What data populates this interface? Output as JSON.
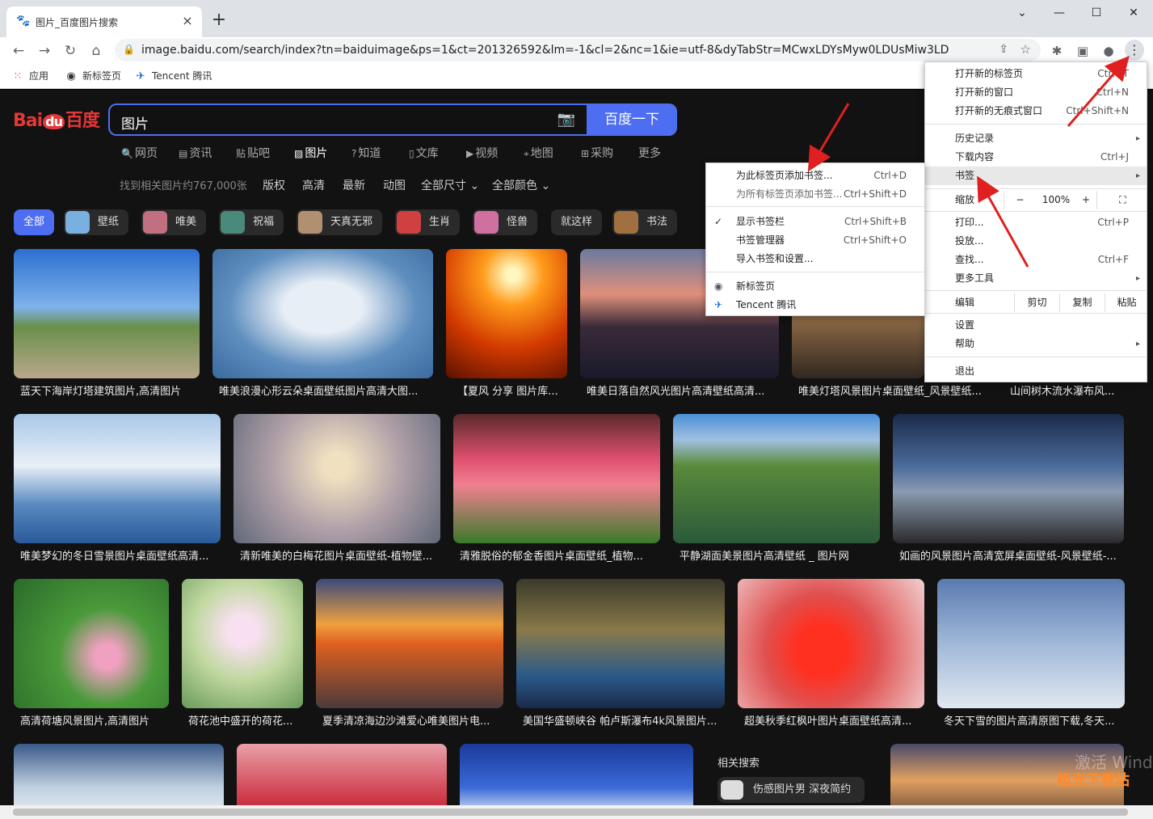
{
  "tab": {
    "title": "图片_百度图片搜索",
    "close": "×",
    "new_tab": "+"
  },
  "window": {
    "minimize": "⌄",
    "min": "—",
    "max": "☐",
    "close": "✕"
  },
  "toolbar": {
    "url": "image.baidu.com/search/index?tn=baiduimage&ps=1&ct=201326592&lm=-1&cl=2&nc=1&ie=utf-8&dyTabStr=MCwxLDYsMyw0LDUsMiw3LDgsOQ%3...",
    "back_icon": "←",
    "forward_icon": "→",
    "reload_icon": "↻",
    "home_icon": "⌂",
    "menu_icon": "⋮"
  },
  "bookmarks": [
    {
      "label": "应用",
      "icon": "apps-icon"
    },
    {
      "label": "新标签页",
      "icon": "globe-icon"
    },
    {
      "label": "Tencent 腾讯",
      "icon": "tencent-icon"
    }
  ],
  "baidu": {
    "logo_left": "Bai",
    "logo_mid": "du",
    "logo_right": "百度",
    "search_value": "图片",
    "search_button": "百度一下",
    "nav": [
      "网页",
      "资讯",
      "贴吧",
      "图片",
      "知道",
      "文库",
      "视频",
      "地图",
      "采购",
      "更多"
    ],
    "result_count": "找到相关图片约767,000张",
    "filters": [
      "版权",
      "高清",
      "最新",
      "动图",
      "全部尺寸",
      "全部颜色"
    ],
    "chips": [
      "全部",
      "壁纸",
      "唯美",
      "祝福",
      "天真无邪",
      "生肖",
      "怪兽",
      "就这样",
      "书法"
    ],
    "related_title": "相关搜索",
    "related_chip": "伤感图片男 深夜简约",
    "watermark": "激活 Wind",
    "watermark2": "极光下载站"
  },
  "images": {
    "row1": [
      "蓝天下海岸灯塔建筑图片,高清图片",
      "唯美浪漫心形云朵桌面壁纸图片高清大图...",
      "【夏风 分享 图片库...",
      "唯美日落自然风光图片高清壁纸高清...",
      "唯美灯塔风景图片桌面壁纸_风景壁纸...",
      "山间树木流水瀑布风..."
    ],
    "row2": [
      "唯美梦幻的冬日雪景图片桌面壁纸高清...",
      "清新唯美的白梅花图片桌面壁纸-植物壁...",
      "清雅脱俗的郁金香图片桌面壁纸_植物...",
      "平静湖面美景图片高清壁纸 _ 图片网",
      "如画的风景图片高清宽屏桌面壁纸-风景壁纸-..."
    ],
    "row3": [
      "高清荷塘风景图片,高清图片",
      "荷花池中盛开的荷花...",
      "夏季清凉海边沙滩爱心唯美图片电...",
      "美国华盛顿峡谷 帕卢斯瀑布4k风景图片...",
      "超美秋季红枫叶图片桌面壁纸高清...",
      "冬天下雪的图片高清原图下载,冬天..."
    ]
  },
  "chrome_menu": {
    "items": [
      {
        "label": "打开新的标签页",
        "shortcut": "Ctrl+T"
      },
      {
        "label": "打开新的窗口",
        "shortcut": "Ctrl+N"
      },
      {
        "label": "打开新的无痕式窗口",
        "shortcut": "Ctrl+Shift+N"
      },
      {
        "label": "历史记录",
        "shortcut": "▸"
      },
      {
        "label": "下载内容",
        "shortcut": "Ctrl+J"
      },
      {
        "label": "书签",
        "shortcut": "▸"
      },
      {
        "label": "缩放",
        "shortcut": ""
      },
      {
        "label": "打印...",
        "shortcut": "Ctrl+P"
      },
      {
        "label": "投放...",
        "shortcut": ""
      },
      {
        "label": "查找...",
        "shortcut": "Ctrl+F"
      },
      {
        "label": "更多工具",
        "shortcut": "▸"
      },
      {
        "label": "编辑",
        "shortcut": ""
      },
      {
        "label": "设置",
        "shortcut": ""
      },
      {
        "label": "帮助",
        "shortcut": "▸"
      },
      {
        "label": "退出",
        "shortcut": ""
      }
    ],
    "zoom": {
      "minus": "−",
      "value": "100%",
      "plus": "+",
      "fullscreen": "⛶"
    },
    "edit": {
      "cut": "剪切",
      "copy": "复制",
      "paste": "粘贴"
    }
  },
  "bookmark_menu": {
    "items": [
      {
        "label": "为此标签页添加书签...",
        "shortcut": "Ctrl+D"
      },
      {
        "label": "为所有标签页添加书签...",
        "shortcut": "Ctrl+Shift+D"
      },
      {
        "label": "显示书签栏",
        "shortcut": "Ctrl+Shift+B",
        "check": "✓"
      },
      {
        "label": "书签管理器",
        "shortcut": "Ctrl+Shift+O"
      },
      {
        "label": "导入书签和设置...",
        "shortcut": ""
      },
      {
        "label": "新标签页",
        "shortcut": ""
      },
      {
        "label": "Tencent 腾讯",
        "shortcut": ""
      }
    ]
  },
  "colors": {
    "accent": "#4e6ef2",
    "baidu_red": "#e23838",
    "arrow": "#e02020"
  }
}
